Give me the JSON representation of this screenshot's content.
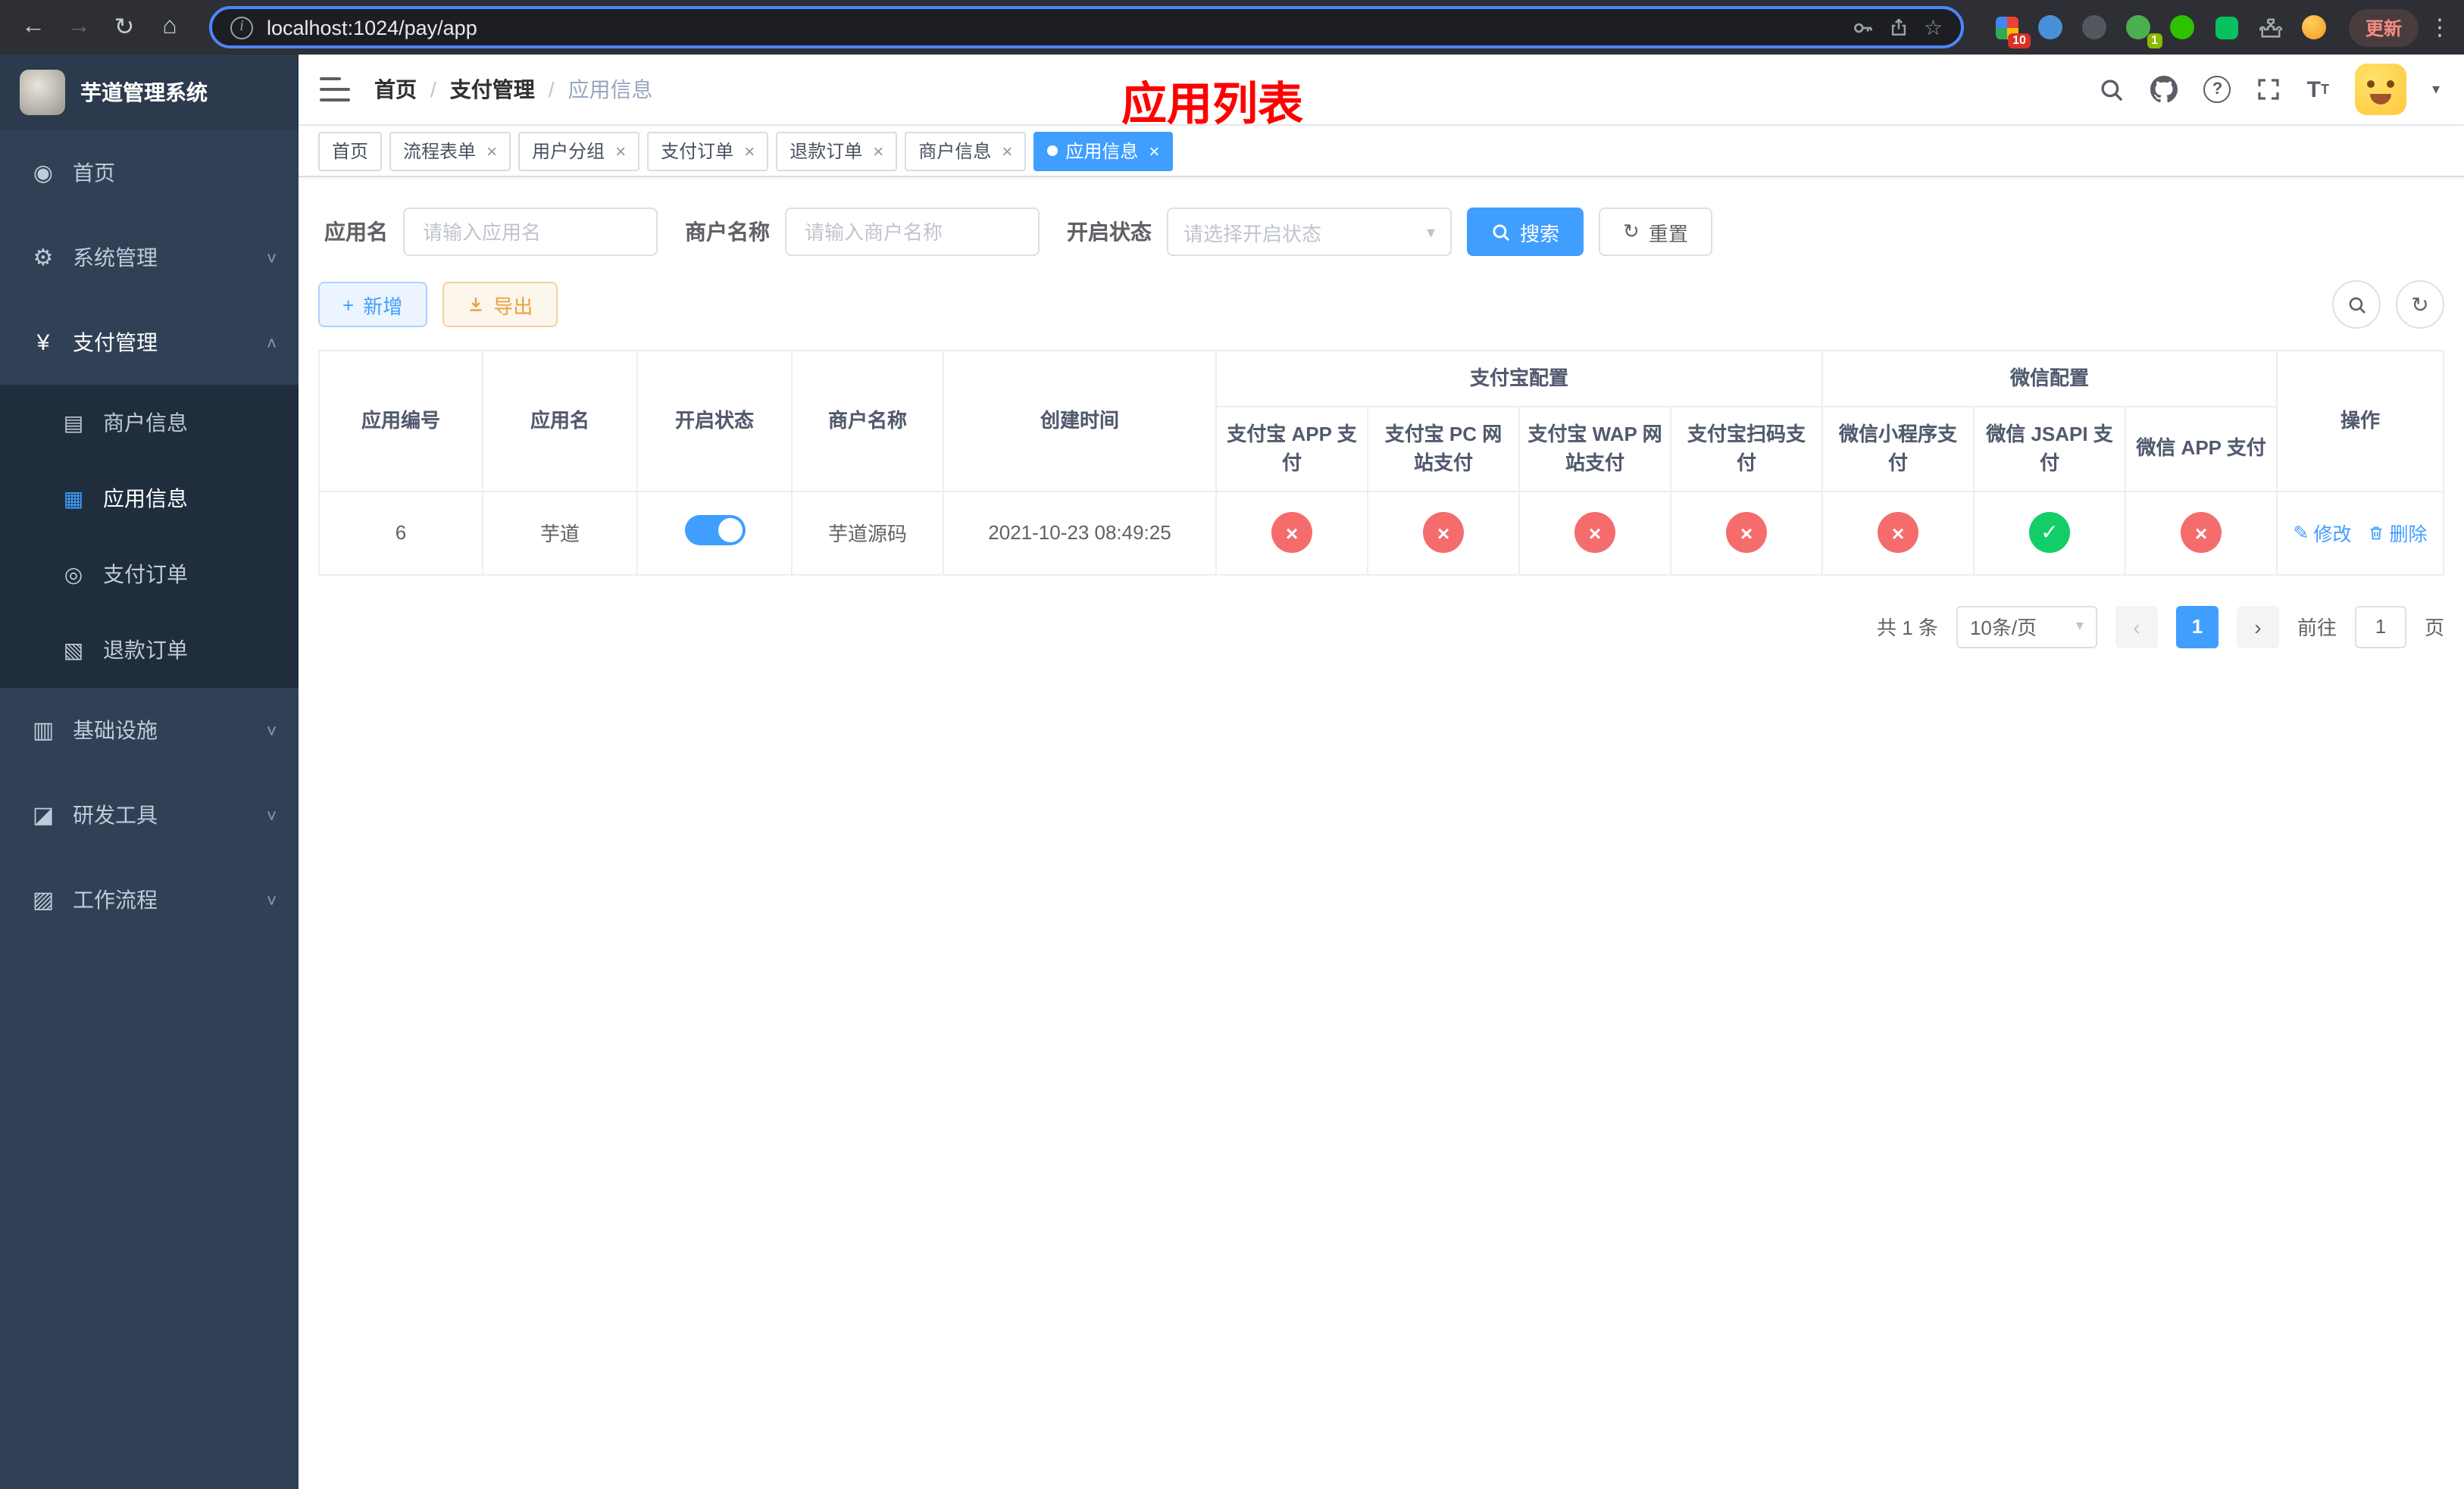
{
  "colors": {
    "primary": "#409eff",
    "danger": "#f56c6c",
    "success": "#13ce66",
    "warning": "#e6a23c",
    "banner_red": "#ff0000",
    "sidebar_bg": "#304156",
    "submenu_bg": "#1f2d3d"
  },
  "browser": {
    "url": "localhost:1024/pay/app",
    "update_label": "更新",
    "extension_badge_1": "10",
    "extension_badge_2": "1"
  },
  "sidebar": {
    "app_title": "芋道管理系统",
    "items": [
      {
        "label": "首页"
      },
      {
        "label": "系统管理"
      },
      {
        "label": "支付管理"
      },
      {
        "label": "基础设施"
      },
      {
        "label": "研发工具"
      },
      {
        "label": "工作流程"
      }
    ],
    "payment_children": [
      {
        "label": "商户信息"
      },
      {
        "label": "应用信息"
      },
      {
        "label": "支付订单"
      },
      {
        "label": "退款订单"
      }
    ]
  },
  "header": {
    "breadcrumb": [
      "首页",
      "支付管理",
      "应用信息"
    ],
    "banner": "应用列表"
  },
  "tabs": [
    {
      "label": "首页"
    },
    {
      "label": "流程表单"
    },
    {
      "label": "用户分组"
    },
    {
      "label": "支付订单"
    },
    {
      "label": "退款订单"
    },
    {
      "label": "商户信息"
    },
    {
      "label": "应用信息"
    }
  ],
  "filters": {
    "app_name_label": "应用名",
    "app_name_placeholder": "请输入应用名",
    "merchant_label": "商户名称",
    "merchant_placeholder": "请输入商户名称",
    "status_label": "开启状态",
    "status_placeholder": "请选择开启状态",
    "search_label": "搜索",
    "reset_label": "重置"
  },
  "toolbar": {
    "add_label": "新增",
    "export_label": "导出"
  },
  "table": {
    "headers": {
      "app_id": "应用编号",
      "app_name": "应用名",
      "status": "开启状态",
      "merchant": "商户名称",
      "created": "创建时间",
      "alipay_group": "支付宝配置",
      "wechat_group": "微信配置",
      "alipay_app": "支付宝 APP 支付",
      "alipay_pc": "支付宝 PC 网站支付",
      "alipay_wap": "支付宝 WAP 网站支付",
      "alipay_qr": "支付宝扫码支付",
      "wx_mini": "微信小程序支付",
      "wx_jsapi": "微信 JSAPI 支付",
      "wx_app": "微信 APP 支付",
      "actions": "操作"
    },
    "rows": [
      {
        "app_id": "6",
        "app_name": "芋道",
        "status_on": true,
        "merchant": "芋道源码",
        "created": "2021-10-23 08:49:25",
        "alipay_app": false,
        "alipay_pc": false,
        "alipay_wap": false,
        "alipay_qr": false,
        "wx_mini": false,
        "wx_jsapi": true,
        "wx_app": false,
        "edit_label": "修改",
        "delete_label": "删除"
      }
    ]
  },
  "pagination": {
    "total": "共 1 条",
    "page_size": "10条/页",
    "current_page": "1",
    "goto_label": "前往",
    "goto_value": "1",
    "page_suffix": "页"
  }
}
